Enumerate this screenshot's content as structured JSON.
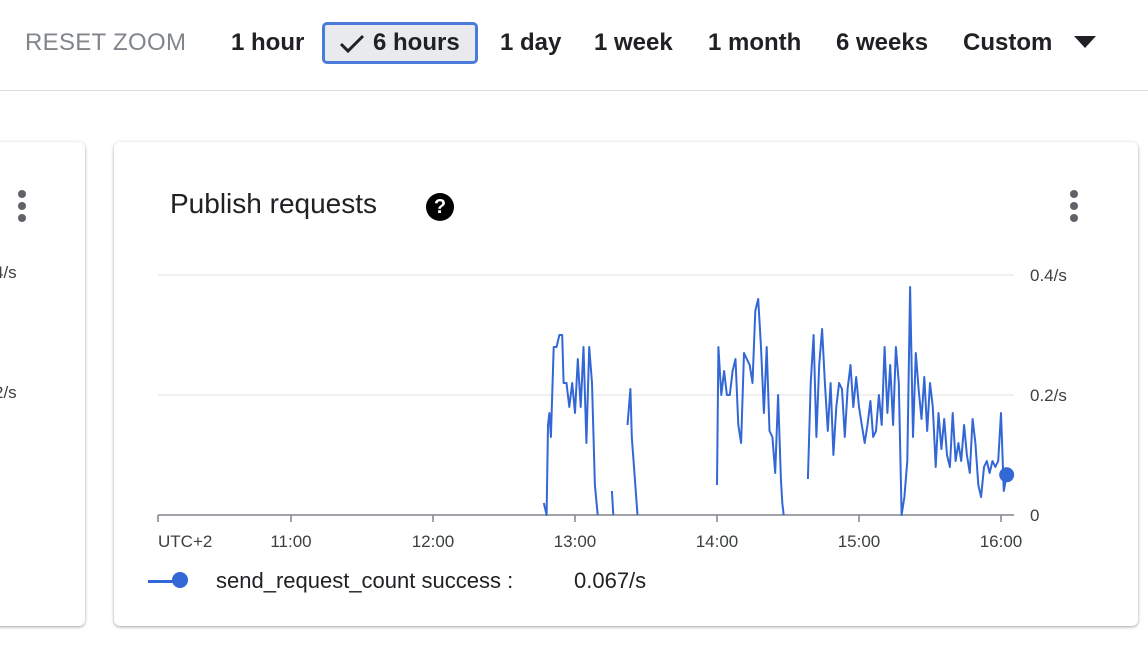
{
  "toolbar": {
    "reset_zoom": "RESET ZOOM",
    "ranges": [
      "1 hour",
      "6 hours",
      "1 day",
      "1 week",
      "1 month",
      "6 weeks",
      "Custom"
    ],
    "selected_range": "6 hours"
  },
  "left_card": {
    "tick_top": "4/s",
    "tick_mid": "2/s"
  },
  "card": {
    "title": "Publish requests",
    "help_glyph": "?",
    "legend": {
      "label": "send_request_count success :",
      "value": "0.067/s"
    }
  },
  "colors": {
    "series": "#3367d6",
    "selected_border": "#4a7bd8",
    "grid": "#e0e0e0"
  },
  "chart_data": {
    "type": "line",
    "title": "Publish requests",
    "x_tick_labels": [
      "UTC+2",
      "11:00",
      "12:00",
      "13:00",
      "14:00",
      "15:00",
      "16:00"
    ],
    "y_tick_labels": [
      "0",
      "0.2/s",
      "0.4/s"
    ],
    "ylim": [
      0,
      0.4
    ],
    "xlim_hours": [
      10.0,
      16.2
    ],
    "grid": true,
    "series": [
      {
        "name": "send_request_count success",
        "segments": [
          [
            [
              12.78,
              0.02
            ],
            [
              12.8,
              0.0
            ],
            [
              12.81,
              0.15
            ],
            [
              12.82,
              0.17
            ],
            [
              12.83,
              0.13
            ],
            [
              12.85,
              0.28
            ],
            [
              12.87,
              0.28
            ],
            [
              12.89,
              0.3
            ],
            [
              12.91,
              0.3
            ],
            [
              12.92,
              0.22
            ],
            [
              12.94,
              0.22
            ],
            [
              12.96,
              0.18
            ],
            [
              12.98,
              0.22
            ],
            [
              13.0,
              0.17
            ],
            [
              13.02,
              0.26
            ],
            [
              13.04,
              0.18
            ],
            [
              13.06,
              0.28
            ],
            [
              13.08,
              0.12
            ],
            [
              13.1,
              0.28
            ],
            [
              13.12,
              0.22
            ],
            [
              13.14,
              0.05
            ],
            [
              13.16,
              0.0
            ]
          ],
          [
            [
              13.26,
              0.04
            ],
            [
              13.27,
              0.0
            ]
          ],
          [
            [
              13.37,
              0.15
            ],
            [
              13.39,
              0.21
            ],
            [
              13.4,
              0.13
            ],
            [
              13.44,
              0.0
            ]
          ],
          [
            [
              14.0,
              0.05
            ],
            [
              14.01,
              0.28
            ],
            [
              14.03,
              0.2
            ],
            [
              14.05,
              0.24
            ],
            [
              14.07,
              0.2
            ],
            [
              14.09,
              0.2
            ],
            [
              14.11,
              0.24
            ],
            [
              14.13,
              0.26
            ],
            [
              14.15,
              0.15
            ],
            [
              14.17,
              0.12
            ],
            [
              14.19,
              0.27
            ],
            [
              14.21,
              0.26
            ],
            [
              14.23,
              0.25
            ],
            [
              14.25,
              0.22
            ],
            [
              14.27,
              0.34
            ],
            [
              14.29,
              0.36
            ],
            [
              14.31,
              0.28
            ],
            [
              14.33,
              0.17
            ],
            [
              14.35,
              0.28
            ],
            [
              14.37,
              0.14
            ],
            [
              14.39,
              0.13
            ],
            [
              14.41,
              0.07
            ],
            [
              14.43,
              0.2
            ],
            [
              14.45,
              0.06
            ],
            [
              14.46,
              0.02
            ],
            [
              14.47,
              0.0
            ]
          ],
          [
            [
              14.64,
              0.06
            ],
            [
              14.66,
              0.22
            ],
            [
              14.68,
              0.3
            ],
            [
              14.7,
              0.13
            ],
            [
              14.72,
              0.25
            ],
            [
              14.74,
              0.31
            ],
            [
              14.76,
              0.22
            ],
            [
              14.78,
              0.14
            ],
            [
              14.8,
              0.22
            ],
            [
              14.82,
              0.1
            ],
            [
              14.84,
              0.18
            ],
            [
              14.86,
              0.22
            ],
            [
              14.88,
              0.21
            ],
            [
              14.9,
              0.13
            ],
            [
              14.92,
              0.21
            ],
            [
              14.94,
              0.25
            ],
            [
              14.96,
              0.18
            ],
            [
              14.98,
              0.23
            ],
            [
              15.0,
              0.18
            ],
            [
              15.02,
              0.15
            ],
            [
              15.04,
              0.12
            ],
            [
              15.06,
              0.15
            ],
            [
              15.08,
              0.19
            ],
            [
              15.1,
              0.13
            ],
            [
              15.12,
              0.14
            ],
            [
              15.14,
              0.2
            ],
            [
              15.16,
              0.15
            ],
            [
              15.18,
              0.28
            ],
            [
              15.2,
              0.17
            ],
            [
              15.22,
              0.25
            ],
            [
              15.24,
              0.15
            ],
            [
              15.26,
              0.28
            ],
            [
              15.28,
              0.22
            ],
            [
              15.3,
              0.0
            ],
            [
              15.32,
              0.03
            ],
            [
              15.34,
              0.09
            ],
            [
              15.36,
              0.38
            ],
            [
              15.38,
              0.13
            ],
            [
              15.4,
              0.27
            ],
            [
              15.42,
              0.21
            ],
            [
              15.44,
              0.16
            ],
            [
              15.46,
              0.23
            ],
            [
              15.48,
              0.14
            ],
            [
              15.5,
              0.22
            ],
            [
              15.52,
              0.18
            ],
            [
              15.54,
              0.08
            ],
            [
              15.56,
              0.17
            ],
            [
              15.58,
              0.11
            ],
            [
              15.6,
              0.16
            ],
            [
              15.62,
              0.1
            ],
            [
              15.64,
              0.08
            ],
            [
              15.66,
              0.17
            ],
            [
              15.68,
              0.09
            ],
            [
              15.7,
              0.12
            ],
            [
              15.72,
              0.09
            ],
            [
              15.74,
              0.15
            ],
            [
              15.76,
              0.1
            ],
            [
              15.78,
              0.07
            ],
            [
              15.8,
              0.16
            ],
            [
              15.82,
              0.12
            ],
            [
              15.84,
              0.05
            ],
            [
              15.86,
              0.03
            ],
            [
              15.88,
              0.08
            ],
            [
              15.9,
              0.09
            ],
            [
              15.92,
              0.07
            ],
            [
              15.94,
              0.09
            ],
            [
              15.96,
              0.08
            ],
            [
              15.98,
              0.09
            ],
            [
              16.0,
              0.17
            ],
            [
              16.02,
              0.04
            ],
            [
              16.04,
              0.067
            ]
          ]
        ],
        "last_value": 0.067
      }
    ]
  }
}
